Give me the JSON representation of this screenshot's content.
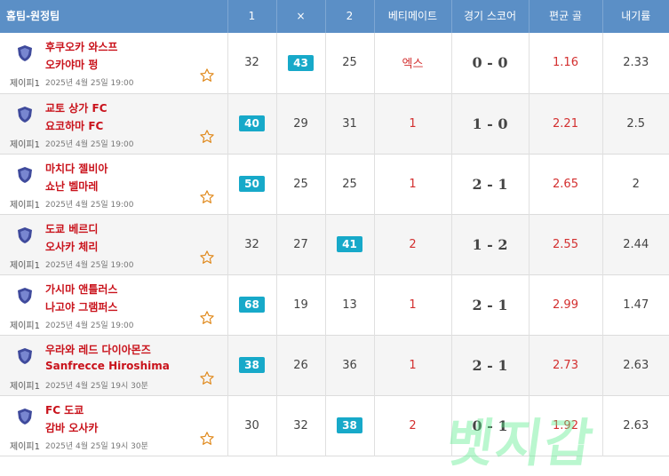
{
  "header": {
    "team": "홈팀-원정팀",
    "col_1": "1",
    "col_x": "×",
    "col_2": "2",
    "betimate": "베티메이트",
    "match_score": "경기 스코어",
    "avg_goals": "편균 골",
    "round": "내기률"
  },
  "matches": [
    {
      "home": "후쿠오카 와스프",
      "away": "오카야마 펑",
      "league": "제이피1",
      "time": "2025년 4월 25일 19:00",
      "o1": "32",
      "ox": "43",
      "o2": "25",
      "pick": "엑스",
      "score": "0 - 0",
      "avg": "1.16",
      "rate": "2.33"
    },
    {
      "home": "교토 상가 FC",
      "away": "요코하마 FC",
      "league": "제이피1",
      "time": "2025년 4월 25일 19:00",
      "o1": "40",
      "ox": "29",
      "o2": "31",
      "pick": "1",
      "score": "1 - 0",
      "avg": "2.21",
      "rate": "2.5"
    },
    {
      "home": "마치다 젤비아",
      "away": "쇼난 벨마레",
      "league": "제이피1",
      "time": "2025년 4월 25일 19:00",
      "o1": "50",
      "ox": "25",
      "o2": "25",
      "pick": "1",
      "score": "2 - 1",
      "avg": "2.65",
      "rate": "2"
    },
    {
      "home": "도쿄 베르디",
      "away": "오사카 체리",
      "league": "제이피1",
      "time": "2025년 4월 25일 19:00",
      "o1": "32",
      "ox": "27",
      "o2": "41",
      "pick": "2",
      "score": "1 - 2",
      "avg": "2.55",
      "rate": "2.44"
    },
    {
      "home": "가시마 앤틀러스",
      "away": "나고야 그램퍼스",
      "league": "제이피1",
      "time": "2025년 4월 25일 19:00",
      "o1": "68",
      "ox": "19",
      "o2": "13",
      "pick": "1",
      "score": "2 - 1",
      "avg": "2.99",
      "rate": "1.47"
    },
    {
      "home": "우라와 레드 다이아몬즈",
      "away": "Sanfrecce Hiroshima",
      "league": "제이피1",
      "time": "2025년 4월 25일 19시 30분",
      "o1": "38",
      "ox": "26",
      "o2": "36",
      "pick": "1",
      "score": "2 - 1",
      "avg": "2.73",
      "rate": "2.63"
    },
    {
      "home": "FC 도쿄",
      "away": "감바 오사카",
      "league": "제이피1",
      "time": "2025년 4월 25일 19시 30분",
      "o1": "30",
      "ox": "32",
      "o2": "38",
      "pick": "2",
      "score": "0 - 1",
      "avg": "1.92",
      "rate": "2.63"
    }
  ],
  "highlight": [
    "ox",
    "o1",
    "o1",
    "o2",
    "o1",
    "o1",
    "o2"
  ],
  "watermark": "벳지갑"
}
